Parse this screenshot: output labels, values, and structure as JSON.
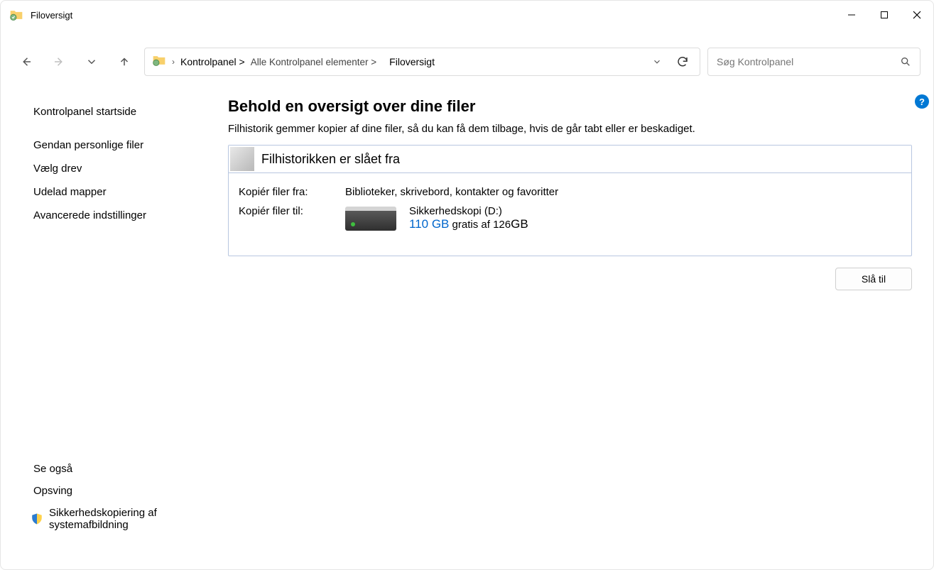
{
  "window": {
    "title": "Filoversigt"
  },
  "breadcrumb": {
    "part1": "Kontrolpanel >",
    "part2": "Alle Kontrolpanel elementer >",
    "part3": "Filoversigt"
  },
  "search": {
    "placeholder": "Søg Kontrolpanel"
  },
  "sidebar": {
    "items": [
      "Kontrolpanel startside",
      "Gendan personlige filer",
      "Vælg drev",
      "Udelad mapper",
      "Avancerede indstillinger"
    ],
    "see_also_header": "Se også",
    "see_also_links": [
      "Opsving",
      "Sikkerhedskopiering af systemafbildning"
    ]
  },
  "main": {
    "heading": "Behold en oversigt over dine filer",
    "description": "Filhistorik gemmer kopier af dine filer, så du kan få dem tilbage, hvis de går tabt eller er beskadiget.",
    "status_title": "Filhistorikken er slået fra",
    "copy_from_label": "Kopiér filer fra:",
    "copy_from_value": "Biblioteker, skrivebord, kontakter og favoritter",
    "copy_to_label": "Kopiér filer til:",
    "drive_name": "Sikkerhedskopi (D:)",
    "drive_free": "110 GB",
    "drive_free_suffix": " gratis af 126",
    "drive_total_unit": "GB",
    "enable_button": "Slå til"
  }
}
